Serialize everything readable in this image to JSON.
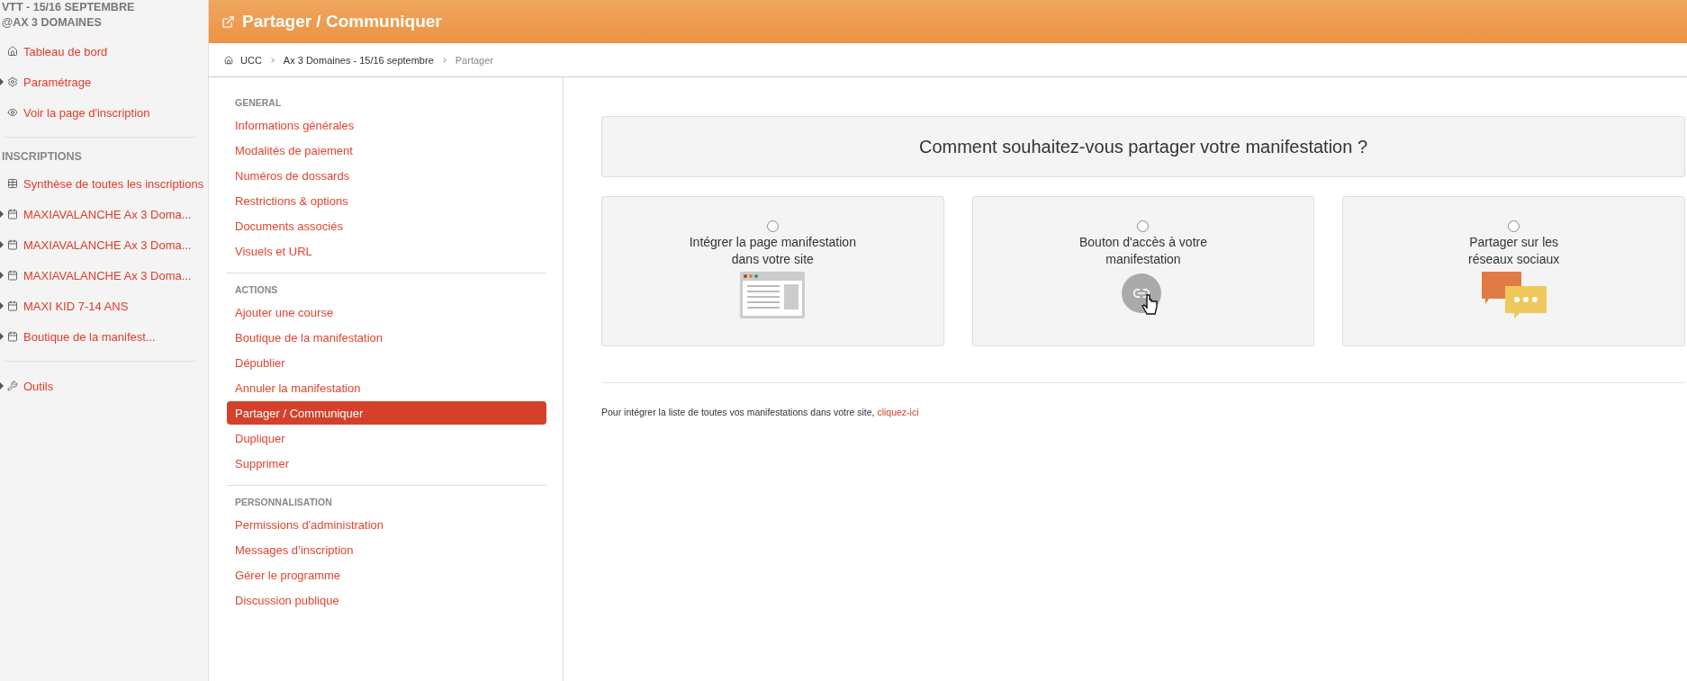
{
  "sidebar": {
    "title_lines": [
      "VTT - 15/16 SEPTEMBRE",
      "@AX 3 DOMAINES"
    ],
    "sections": [
      {
        "items": [
          {
            "label": "Tableau de bord",
            "kind": "home",
            "expandable": false
          },
          {
            "label": "Paramétrage",
            "kind": "cog",
            "expandable": true
          },
          {
            "label": "Voir la page d'inscription",
            "kind": "eye",
            "expandable": false
          }
        ]
      },
      {
        "heading": "INSCRIPTIONS",
        "items": [
          {
            "label": "Synthèse de toutes les inscriptions",
            "kind": "table",
            "expandable": false
          },
          {
            "label": "MAXIAVALANCHE Ax 3 Doma...",
            "kind": "calendar",
            "expandable": true
          },
          {
            "label": "MAXIAVALANCHE Ax 3 Doma...",
            "kind": "calendar",
            "expandable": true
          },
          {
            "label": "MAXIAVALANCHE Ax 3 Doma...",
            "kind": "calendar",
            "expandable": true
          },
          {
            "label": "MAXI KID 7-14 ANS",
            "kind": "calendar",
            "expandable": true
          },
          {
            "label": "Boutique de la manifest...",
            "kind": "calendar",
            "expandable": true
          }
        ]
      },
      {
        "items": [
          {
            "label": "Outils",
            "kind": "wrench",
            "expandable": true
          }
        ]
      }
    ]
  },
  "header": {
    "title": "Partager / Communiquer"
  },
  "breadcrumb": [
    {
      "label": "UCC",
      "current": false
    },
    {
      "label": "Ax 3 Domaines - 15/16 septembre",
      "current": false
    },
    {
      "label": "Partager",
      "current": true
    }
  ],
  "menu": [
    {
      "heading": "GENERAL",
      "items": [
        {
          "label": "Informations générales",
          "selected": false
        },
        {
          "label": "Modalités de paiement",
          "selected": false
        },
        {
          "label": "Numéros de dossards",
          "selected": false
        },
        {
          "label": "Restrictions & options",
          "selected": false
        },
        {
          "label": "Documents associés",
          "selected": false
        },
        {
          "label": "Visuels et URL",
          "selected": false
        }
      ]
    },
    {
      "heading": "ACTIONS",
      "items": [
        {
          "label": "Ajouter une course",
          "selected": false
        },
        {
          "label": "Boutique de la manifestation",
          "selected": false
        },
        {
          "label": "Dépublier",
          "selected": false
        },
        {
          "label": "Annuler la manifestation",
          "selected": false
        },
        {
          "label": "Partager / Communiquer",
          "selected": true
        },
        {
          "label": "Dupliquer",
          "selected": false
        },
        {
          "label": "Supprimer",
          "selected": false
        }
      ]
    },
    {
      "heading": "PERSONNALISATION",
      "items": [
        {
          "label": "Permissions d'administration",
          "selected": false
        },
        {
          "label": "Messages d’inscription",
          "selected": false
        },
        {
          "label": "Gérer le programme",
          "selected": false
        },
        {
          "label": "Discussion publique",
          "selected": false
        }
      ]
    }
  ],
  "question": "Comment souhaitez-vous partager votre manifestation ?",
  "options": [
    {
      "label_lines": [
        "Intégrer la page manifestation",
        "dans votre site"
      ],
      "kind": "browser",
      "selected": false
    },
    {
      "label_lines": [
        "Bouton d'accès à votre",
        "manifestation"
      ],
      "kind": "link",
      "selected": false
    },
    {
      "label_lines": [
        "Partager sur les",
        "réseaux sociaux"
      ],
      "kind": "chat",
      "selected": false
    }
  ],
  "footer_note": {
    "text": "Pour intégrer la liste de toutes vos manifestations dans votre site,",
    "link": "cliquez-ici"
  }
}
